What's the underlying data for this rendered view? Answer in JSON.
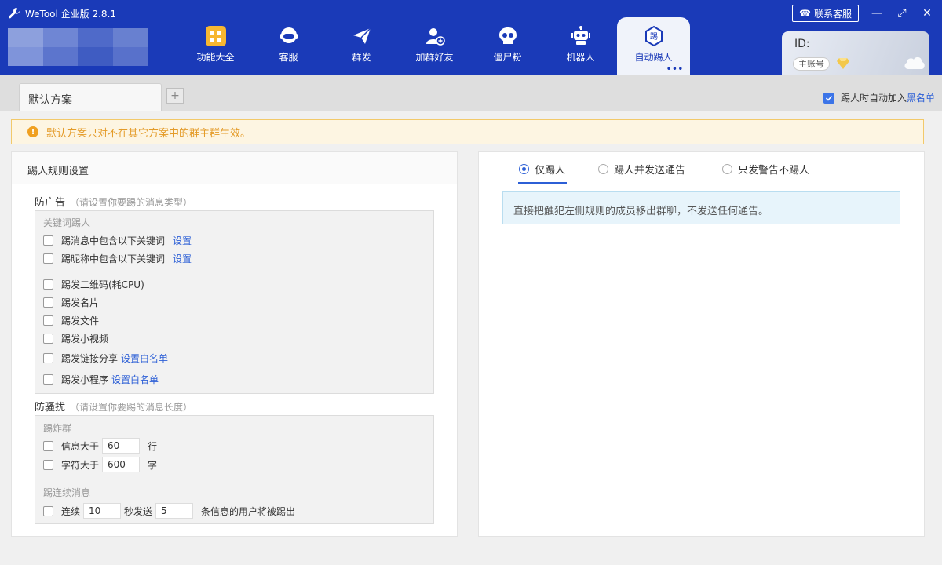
{
  "app": {
    "title": "WeTool 企业版 2.8.1"
  },
  "header": {
    "contact_label": "联系客服",
    "nav": [
      {
        "label": "功能大全",
        "icon": "grid-icon"
      },
      {
        "label": "客服",
        "icon": "headset-icon"
      },
      {
        "label": "群发",
        "icon": "paper-plane-icon"
      },
      {
        "label": "加群好友",
        "icon": "add-user-icon"
      },
      {
        "label": "僵尸粉",
        "icon": "skull-icon"
      },
      {
        "label": "机器人",
        "icon": "robot-icon"
      },
      {
        "label": "自动踢人",
        "icon": "kick-icon",
        "icon_text": "踢",
        "active": true
      }
    ],
    "account": {
      "id_label": "ID:",
      "role": "主账号"
    }
  },
  "tabs": {
    "active_tab": "默认方案",
    "add_label": "+",
    "blacklist": {
      "prefix": "踢人时自动加入",
      "link": "黑名单",
      "checked": true
    }
  },
  "warning": {
    "text": "默认方案只对不在其它方案中的群主群生效。"
  },
  "left": {
    "title": "踢人规则设置",
    "ad": {
      "title": "防广告",
      "hint": "（请设置你要踢的消息类型）",
      "group_label": "关键词踢人",
      "keyword_msg": {
        "label": "踢消息中包含以下关键词",
        "link": "设置"
      },
      "keyword_nick": {
        "label": "踢昵称中包含以下关键词",
        "link": "设置"
      },
      "qrcode": "踢发二维码(耗CPU)",
      "card": "踢发名片",
      "file": "踢发文件",
      "video": "踢发小视频",
      "link_share": {
        "label": "踢发链接分享",
        "link": "设置白名单"
      },
      "mini_program": {
        "label": "踢发小程序",
        "link": "设置白名单"
      }
    },
    "spam": {
      "title": "防骚扰",
      "hint": "（请设置你要踢的消息长度）",
      "bomb_label": "踢炸群",
      "lines": {
        "label": "信息大于",
        "value": "60",
        "unit": "行"
      },
      "chars": {
        "label": "字符大于",
        "value": "600",
        "unit": "字"
      },
      "continuous_label": "踢连续消息",
      "continuous": {
        "label": "连续",
        "seconds": "10",
        "mid": "秒发送",
        "count": "5",
        "suffix": "条信息的用户将被踢出"
      }
    }
  },
  "right": {
    "options": [
      "仅踢人",
      "踢人并发送通告",
      "只发警告不踢人"
    ],
    "selected": "仅踢人",
    "info": "直接把触犯左侧规则的成员移出群聊，不发送任何通告。"
  },
  "colors": {
    "header": "#1a3ab8",
    "accent": "#2c5fd6",
    "warning": "#e49b28"
  }
}
